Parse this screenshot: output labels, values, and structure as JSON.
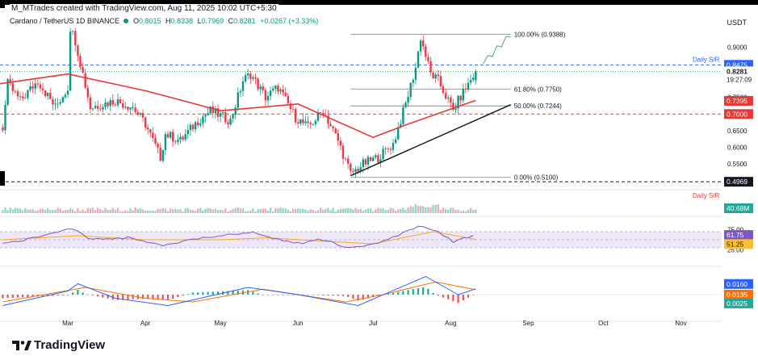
{
  "header": {
    "attribution": "M_MTrades created with TradingView.com, Aug 11, 2025 10:02 UTC+5:30",
    "symbol": "Cardano / TetherUS",
    "interval": "1D",
    "exchange": "BINANCE",
    "ohlc": {
      "O": "0.8015",
      "H": "0.8338",
      "L": "0.7969",
      "C": "0.8281",
      "change": "+0.0267 (+3.33%)"
    },
    "currency": "USDT"
  },
  "branding": {
    "name": "TradingView",
    "icon": "tradingview-logo-icon"
  },
  "colors": {
    "up": "#089981",
    "down": "#f23645",
    "ema": "#e53935",
    "fib": "#787b86",
    "sr": "#2962ff",
    "support": "#e53935",
    "rsi": "#7e57c2",
    "rsi_ma": "#f9a825",
    "macd": "#2962ff",
    "signal": "#ff6d00",
    "trend": "#131722",
    "projection": "#4caf50"
  },
  "chart_data": {
    "type": "candlestick",
    "x_axis": {
      "ticks": [
        "Mar",
        "Apr",
        "May",
        "Jun",
        "Jul",
        "Aug",
        "Sep",
        "Oct",
        "Nov"
      ]
    },
    "price_axis": {
      "ticks": [
        "0.9000",
        "0.8000",
        "0.7500",
        "0.6500",
        "0.6000",
        "0.5500"
      ],
      "range": [
        0.48,
        0.98
      ]
    },
    "ohlc_path": [
      [
        "Feb 03",
        0.66
      ],
      [
        "Feb 05",
        0.79
      ],
      [
        "Feb 10",
        0.74
      ],
      [
        "Feb 17",
        0.8
      ],
      [
        "Feb 24",
        0.72
      ],
      [
        "Mar 01",
        0.78
      ],
      [
        "Mar 02",
        0.96
      ],
      [
        "Mar 04",
        0.92
      ],
      [
        "Mar 07",
        0.82
      ],
      [
        "Mar 10",
        0.72
      ],
      [
        "Mar 15",
        0.73
      ],
      [
        "Mar 20",
        0.74
      ],
      [
        "Mar 27",
        0.72
      ],
      [
        "Apr 01",
        0.67
      ],
      [
        "Apr 07",
        0.57
      ],
      [
        "Apr 09",
        0.64
      ],
      [
        "Apr 15",
        0.62
      ],
      [
        "Apr 22",
        0.68
      ],
      [
        "Apr 27",
        0.71
      ],
      [
        "May 05",
        0.68
      ],
      [
        "May 10",
        0.8
      ],
      [
        "May 13",
        0.82
      ],
      [
        "May 19",
        0.75
      ],
      [
        "May 24",
        0.78
      ],
      [
        "May 31",
        0.69
      ],
      [
        "Jun 05",
        0.66
      ],
      [
        "Jun 11",
        0.71
      ],
      [
        "Jun 17",
        0.62
      ],
      [
        "Jun 22",
        0.52
      ],
      [
        "Jun 27",
        0.55
      ],
      [
        "Jul 03",
        0.57
      ],
      [
        "Jul 09",
        0.61
      ],
      [
        "Jul 14",
        0.73
      ],
      [
        "Jul 18",
        0.84
      ],
      [
        "Jul 20",
        0.93
      ],
      [
        "Jul 24",
        0.82
      ],
      [
        "Jul 27",
        0.8
      ],
      [
        "Aug 02",
        0.71
      ],
      [
        "Aug 04",
        0.74
      ],
      [
        "Aug 08",
        0.79
      ],
      [
        "Aug 11",
        0.8281
      ]
    ],
    "ema": {
      "points": [
        [
          "Feb 01",
          0.79
        ],
        [
          "Mar 01",
          0.82
        ],
        [
          "Apr 01",
          0.77
        ],
        [
          "May 01",
          0.71
        ],
        [
          "Jun 01",
          0.73
        ],
        [
          "Jul 01",
          0.63
        ],
        [
          "Jul 15",
          0.67
        ],
        [
          "Aug 11",
          0.741
        ]
      ],
      "price_label": "0.7395"
    },
    "current_price": {
      "label": "0.8281",
      "countdown": "19:27:09"
    },
    "fibonacci": [
      {
        "level": "100.00%",
        "price": "(0.9388)",
        "value": 0.9388
      },
      {
        "level": "61.80%",
        "price": "(0.7750)",
        "value": 0.775
      },
      {
        "level": "50.00%",
        "price": "(0.7244)",
        "value": 0.7244
      },
      {
        "level": "0.00%",
        "price": "(0.5100)",
        "value": 0.51
      }
    ],
    "daily_sr": {
      "label": "Daily S/R",
      "value": 0.8475,
      "price_label": "0.8475"
    },
    "support": {
      "value": 0.7,
      "price_label": "0.7000"
    },
    "low_line": {
      "value": 0.4969,
      "price_label": "0.4969"
    },
    "trendline": {
      "from": [
        "Jun 22",
        0.515
      ],
      "to": [
        "Aug 25",
        0.728
      ]
    },
    "projection": {
      "from": [
        "Aug 14",
        0.851
      ],
      "to": [
        "Aug 25",
        0.938
      ]
    },
    "volume": {
      "label": "40.68M"
    },
    "rsi": {
      "ticks": [
        "75.00",
        "25.00"
      ],
      "value_label": "61.75",
      "ma_label": "51.25",
      "path": [
        [
          "Feb 03",
          40
        ],
        [
          "Feb 20",
          60
        ],
        [
          "Mar 02",
          80
        ],
        [
          "Mar 10",
          50
        ],
        [
          "Mar 25",
          55
        ],
        [
          "Apr 07",
          35
        ],
        [
          "Apr 25",
          55
        ],
        [
          "May 13",
          70
        ],
        [
          "May 31",
          40
        ],
        [
          "Jun 10",
          50
        ],
        [
          "Jun 22",
          30
        ],
        [
          "Jul 05",
          45
        ],
        [
          "Jul 20",
          85
        ],
        [
          "Jul 27",
          70
        ],
        [
          "Aug 02",
          45
        ],
        [
          "Aug 06",
          55
        ],
        [
          "Aug 11",
          62
        ]
      ],
      "ma": [
        [
          "Feb 03",
          50
        ],
        [
          "Mar 05",
          60
        ],
        [
          "Apr 01",
          50
        ],
        [
          "May 01",
          50
        ],
        [
          "May 20",
          55
        ],
        [
          "Jun 15",
          45
        ],
        [
          "Jul 01",
          40
        ],
        [
          "Jul 25",
          70
        ],
        [
          "Aug 11",
          51
        ]
      ]
    },
    "macd": {
      "macd_label": "0.0160",
      "signal_label": "0.0135",
      "hist_label": "0.0025",
      "macd_path": [
        [
          "Feb 03",
          -0.03
        ],
        [
          "Mar 01",
          0.01
        ],
        [
          "Mar 05",
          0.03
        ],
        [
          "Mar 20",
          -0.01
        ],
        [
          "Apr 10",
          -0.03
        ],
        [
          "May 12",
          0.02
        ],
        [
          "Jun 01",
          0.0
        ],
        [
          "Jun 25",
          -0.03
        ],
        [
          "Jul 22",
          0.05
        ],
        [
          "Aug 04",
          0.0
        ],
        [
          "Aug 11",
          0.016
        ]
      ],
      "signal_path": [
        [
          "Feb 03",
          -0.02
        ],
        [
          "Mar 08",
          0.02
        ],
        [
          "Apr 01",
          -0.01
        ],
        [
          "Apr 20",
          -0.02
        ],
        [
          "May 18",
          0.015
        ],
        [
          "Jun 20",
          -0.02
        ],
        [
          "Jul 05",
          0.0
        ],
        [
          "Jul 26",
          0.035
        ],
        [
          "Aug 11",
          0.0135
        ]
      ]
    }
  }
}
